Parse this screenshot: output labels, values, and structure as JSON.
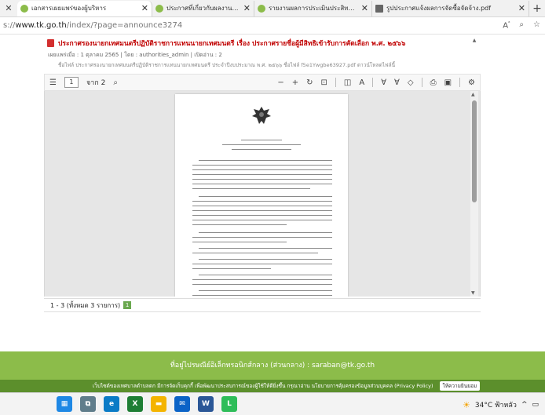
{
  "browser": {
    "tabs": [
      {
        "label": "เอกสารเผยแพร่ของผู้บริหาร",
        "fav_color": "#8cbc4a",
        "active": true
      },
      {
        "label": "ประกาศที่เกี่ยวกับผลงานรายงานผลการดำเนินการ",
        "fav_color": "#8cbc4a",
        "active": false
      },
      {
        "label": "รายงานผลการประเมินประสิทธิภาพ",
        "fav_color": "#8cbc4a",
        "active": false
      },
      {
        "label": "รูปประกาศแจ้งผลการจัดซื้อจัดจ้าง.pdf",
        "fav_color": "#666666",
        "active": false
      }
    ],
    "url_prefix": "s://",
    "url_domain": "www.tk.go.th",
    "url_path": "/index/?page=announce3274",
    "icons": [
      "read-aloud-icon",
      "zoom-icon",
      "favorite-icon"
    ]
  },
  "announcement": {
    "title": "ประกาศรองนายกเทศมนตรีปฏิบัติราชการแทนนายกเทศมนตรี เรื่อง ประกาศรายชื่อผู้มีสิทธิเข้ารับการคัดเลือก พ.ศ. ๒๕๖๖",
    "meta": "เผยแพร่เมื่อ : 1 ตุลาคม 2565 | โดย : authorities_admin | เปิดอ่าน : 2",
    "meta2": "ชื่อไฟล์ ประกาศรองนายกเทศมนตรีปฏิบัติราชการแทนนายกเทศมนตรี ประจำปีงบประมาณ พ.ศ. ๒๕๖๖   ชื่อไฟล์ f5e1Ywgbe63927.pdf   ดาวน์โหลดไฟล์นี้"
  },
  "pdf_toolbar": {
    "page_current": "1",
    "page_total": "จาก 2",
    "icons": [
      "contents-icon",
      "search-icon",
      "zoom-out-icon",
      "zoom-in-icon",
      "rotate-icon",
      "fit-page-icon",
      "page-view-icon",
      "read-aloud-icon",
      "draw-icon",
      "highlight-icon",
      "erase-icon",
      "print-icon",
      "save-icon",
      "settings-icon"
    ]
  },
  "results": {
    "text": "1 - 3 (ทั้งหมด 3 รายการ)",
    "page": "1"
  },
  "footer": {
    "email_line": "ที่อยู่ไปรษณีย์อิเล็กทรอนิกส์กลาง (ส่วนกลาง) : saraban@tk.go.th",
    "policy_line": "เว็บไซต์ของเทศบาลตำบลตก มีการจัดเก็บคุกกี้ เพื่อพัฒนาประสบการณ์ของผู้ใช้ให้ดียิ่งขึ้น กรุณาอ่าน นโยบายการคุ้มครองข้อมูลส่วนบุคคล (Privacy Policy)",
    "accept_label": "ให้ความยินยอม"
  },
  "taskbar": {
    "apps": [
      {
        "name": "windows-icon",
        "color": "#1e88e5"
      },
      {
        "name": "task-view-icon",
        "color": "#607d8b"
      },
      {
        "name": "edge-icon",
        "color": "#0a7bc6"
      },
      {
        "name": "excel-icon",
        "color": "#1e7e34"
      },
      {
        "name": "file-explorer-icon",
        "color": "#f4b400"
      },
      {
        "name": "mail-icon",
        "color": "#0b63c7"
      },
      {
        "name": "word-icon",
        "color": "#2b5797"
      },
      {
        "name": "line-icon",
        "color": "#2ebd59"
      }
    ],
    "weather": "34°C ฟ้าหลัว",
    "tray_arrow": "^"
  }
}
